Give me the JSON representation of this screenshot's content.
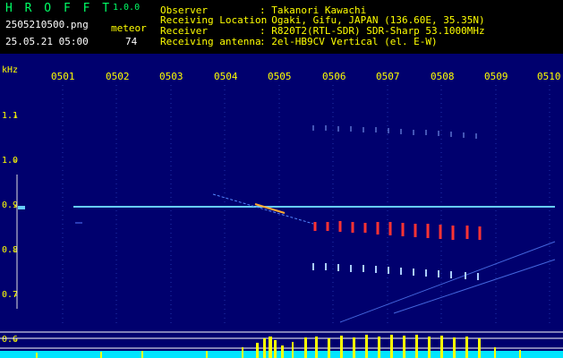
{
  "header": {
    "app_title": "H R O F F T",
    "version": "1.0.0",
    "filename": "2505210500.png",
    "meteor_label": "meteor",
    "datetime": "25.05.21 05:00",
    "meteor_count": "74",
    "info": [
      {
        "label": "Observer",
        "value": ": Takanori Kawachi"
      },
      {
        "label": "Receiving Location",
        "value": ": Ogaki, Gifu, JAPAN (136.60E, 35.35N)"
      },
      {
        "label": "Receiver",
        "value": ": R820T2(RTL-SDR) SDR-Sharp 53.1000MHz"
      },
      {
        "label": "Receiving antenna",
        "value": ": 2el-HB9CV Vertical (el. E-W)"
      }
    ]
  },
  "spectrogram": {
    "unit": "kHz",
    "x_ticks": [
      "0501",
      "0502",
      "0503",
      "0504",
      "0505",
      "0506",
      "0507",
      "0508",
      "0509",
      "0510"
    ],
    "y_ticks": [
      "1.1",
      "1.0",
      "0.9",
      "0.8",
      "0.7",
      "0.6"
    ],
    "colors": {
      "background": "#00006e",
      "labels": "#ffff00",
      "carrier": "#66ccff",
      "echo": "#ff3333",
      "histogram": "#ffff00",
      "baseline": "#00e5ff"
    }
  }
}
